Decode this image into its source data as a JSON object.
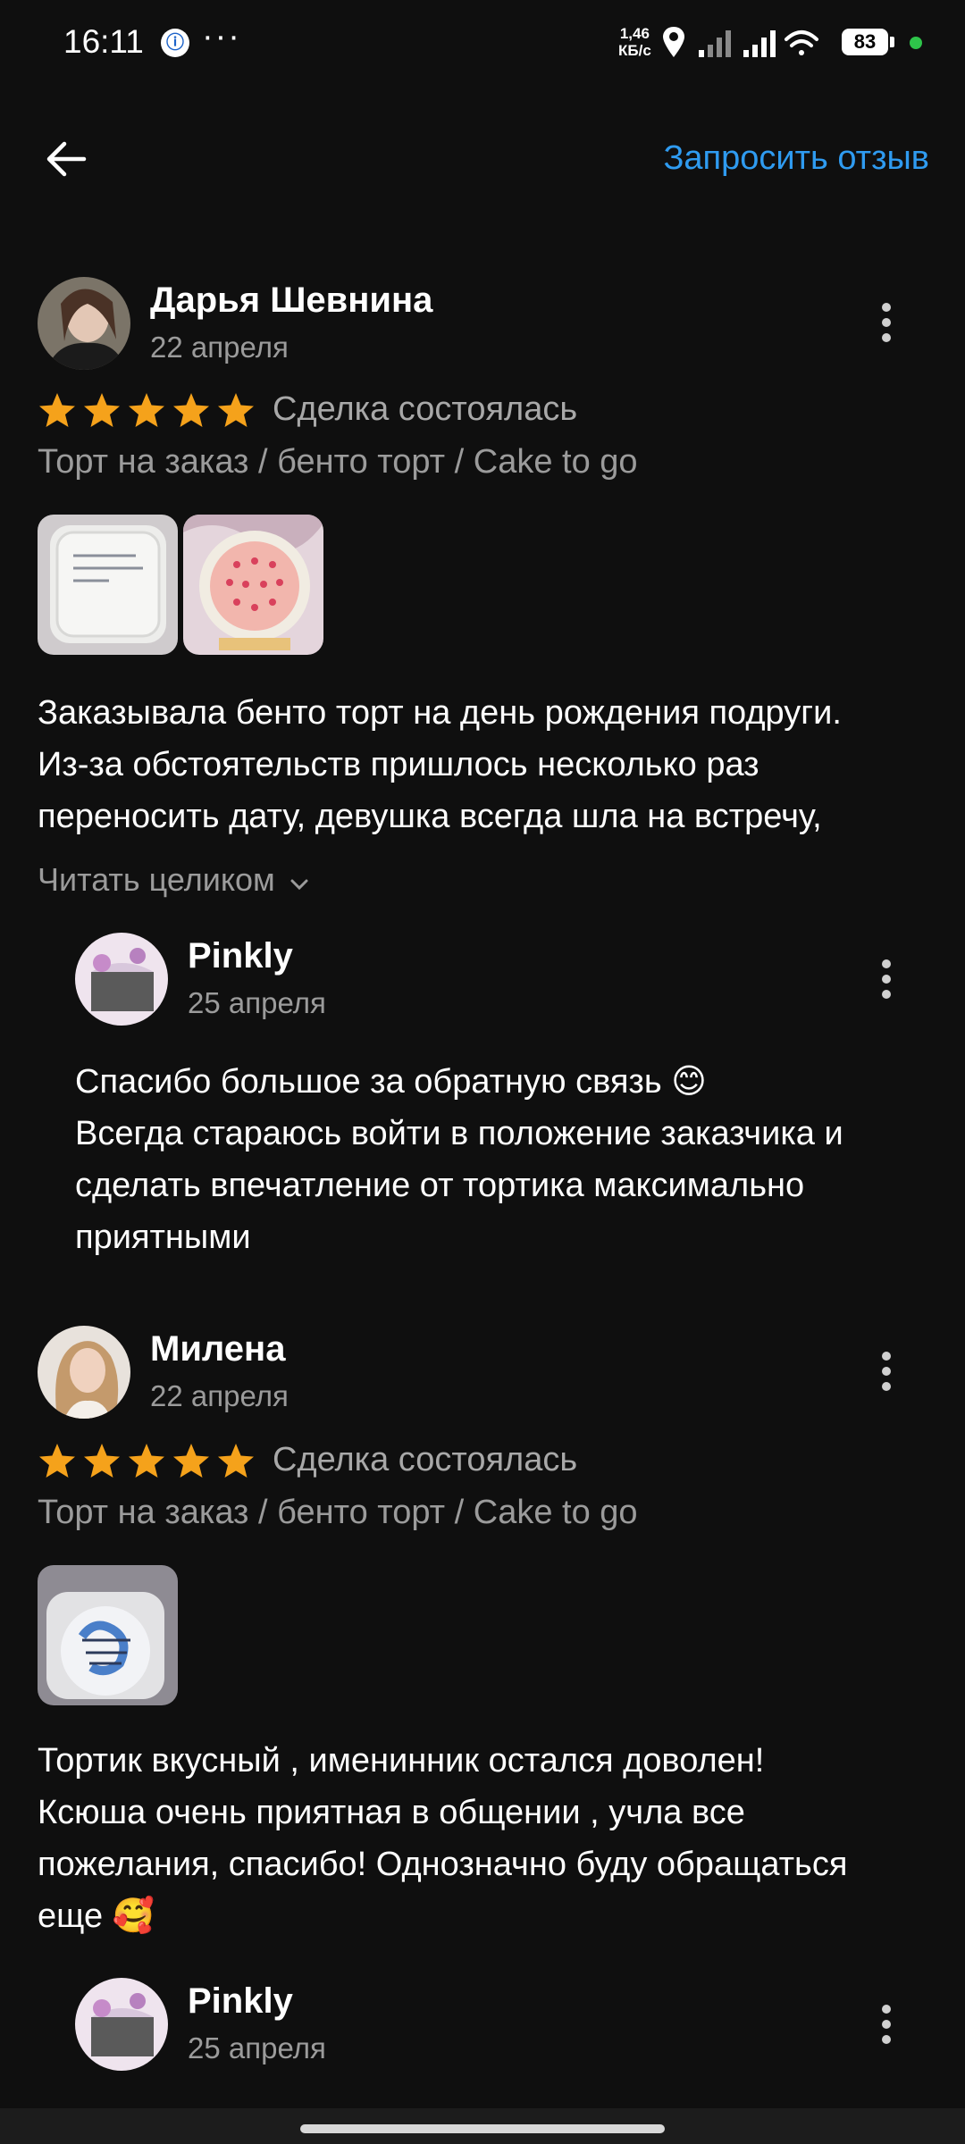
{
  "status_bar": {
    "time": "16:11",
    "net_speed_value": "1,46",
    "net_speed_unit": "КБ/с",
    "battery": "83",
    "icons": [
      "app-notification-icon",
      "more-dots-icon",
      "location-icon",
      "signal-icon",
      "signal-icon",
      "wifi-icon",
      "battery-icon"
    ]
  },
  "header": {
    "back_icon": "arrow-left-icon",
    "request_review_label": "Запросить отзыв"
  },
  "reviews": [
    {
      "name": "Дарья Шевнина",
      "date": "22 апреля",
      "rating": 5,
      "deal_status": "Сделка состоялась",
      "category": "Торт на заказ / бенто торт / Cake to go",
      "text_lines": [
        "Заказывала бенто торт на день рождения подруги.",
        "Из-за обстоятельств пришлось несколько раз",
        "переносить дату, девушка всегда шла на встречу,"
      ],
      "read_more": "Читать целиком",
      "reply": {
        "name": "Pinkly",
        "date": "25 апреля",
        "text_lines": [
          "Спасибо большое за обратную связь 😊",
          "Всегда стараюсь войти в положение заказчика и",
          "сделать впечатление от тортика максимально",
          "приятными"
        ]
      }
    },
    {
      "name": "Милена",
      "date": "22 апреля",
      "rating": 5,
      "deal_status": "Сделка состоялась",
      "category": "Торт на заказ / бенто торт / Cake to go",
      "text_lines": [
        "Тортик вкусный , именинник остался доволен!",
        "Ксюша очень приятная в общении , учла все",
        "пожелания, спасибо! Однозначно буду обращаться",
        "еще 🥰"
      ],
      "reply": {
        "name": "Pinkly",
        "date": "25 апреля"
      }
    }
  ],
  "colors": {
    "background": "#0f0f0f",
    "accent_link": "#2f9bf0",
    "star": "#f5a21b",
    "secondary_text": "#9b9b9b"
  }
}
